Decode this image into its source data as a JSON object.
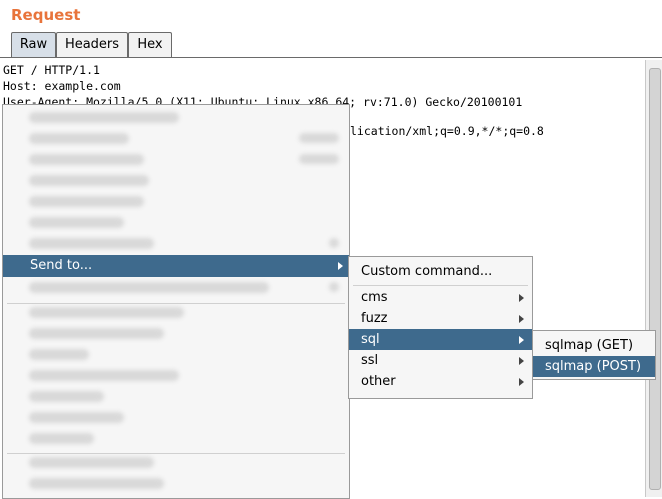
{
  "panel": {
    "title": "Request"
  },
  "tabs": [
    {
      "label": "Raw",
      "active": true
    },
    {
      "label": "Headers",
      "active": false
    },
    {
      "label": "Hex",
      "active": false
    }
  ],
  "editor": {
    "lines": [
      "GET / HTTP/1.1",
      "Host: example.com",
      "User-Agent: Mozilla/5.0 (X11; Ubuntu; Linux x86_64; rv:71.0) Gecko/20100101"
    ],
    "partial_line": "lication/xml;q=0.9,*/*;q=0.8"
  },
  "context_menu": {
    "selected_item": {
      "label": "Send to..."
    }
  },
  "submenu": {
    "items": [
      {
        "label": "Custom command...",
        "has_submenu": false,
        "selected": false
      },
      {
        "label": "cms",
        "has_submenu": true,
        "selected": false
      },
      {
        "label": "fuzz",
        "has_submenu": true,
        "selected": false
      },
      {
        "label": "sql",
        "has_submenu": true,
        "selected": true
      },
      {
        "label": "ssl",
        "has_submenu": true,
        "selected": false
      },
      {
        "label": "other",
        "has_submenu": true,
        "selected": false
      }
    ]
  },
  "sql_submenu": {
    "items": [
      {
        "label": "sqlmap (GET)",
        "selected": false
      },
      {
        "label": "sqlmap (POST)",
        "selected": true
      }
    ]
  },
  "colors": {
    "title": "#e8743b",
    "selection": "#3e6a8d"
  }
}
